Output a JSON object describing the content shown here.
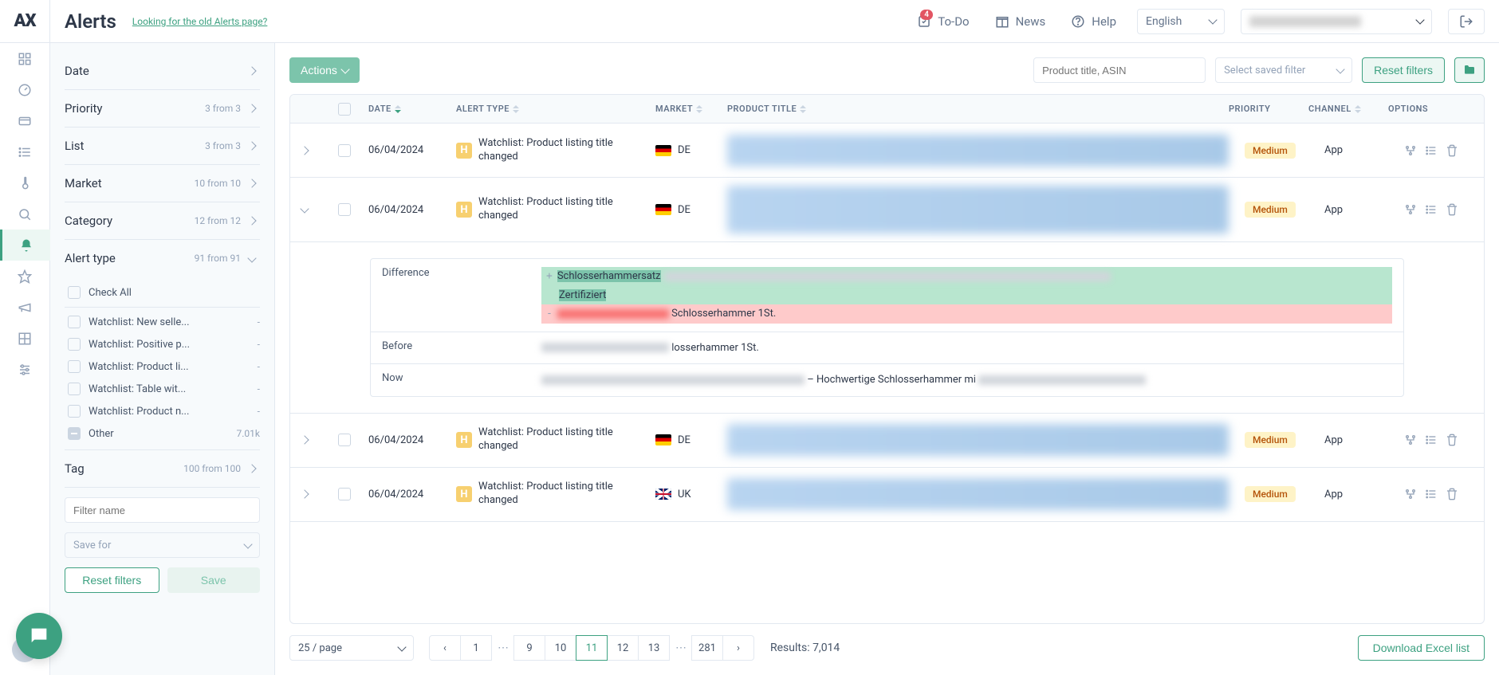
{
  "header": {
    "logo": "AX",
    "title": "Alerts",
    "old_link": "Looking for the old Alerts page?",
    "todo": {
      "label": "To-Do",
      "badge": "4"
    },
    "news": "News",
    "help": "Help",
    "language": "English"
  },
  "filters": {
    "date": {
      "label": "Date"
    },
    "priority": {
      "label": "Priority",
      "count": "3 from 3"
    },
    "list": {
      "label": "List",
      "count": "3 from 3"
    },
    "market": {
      "label": "Market",
      "count": "10 from 10"
    },
    "category": {
      "label": "Category",
      "count": "12 from 12"
    },
    "alert_type": {
      "label": "Alert type",
      "count": "91 from 91",
      "check_all": "Check All",
      "items": [
        {
          "label": "Watchlist: New selle...",
          "count": "-"
        },
        {
          "label": "Watchlist: Positive p...",
          "count": "-"
        },
        {
          "label": "Watchlist: Product li...",
          "count": "-"
        },
        {
          "label": "Watchlist: Table wit...",
          "count": "-"
        },
        {
          "label": "Watchlist: Product n...",
          "count": "-"
        }
      ],
      "other": {
        "label": "Other",
        "count": "7.01k"
      }
    },
    "tag": {
      "label": "Tag",
      "count": "100 from 100",
      "placeholder": "Filter name"
    },
    "save_for": "Save for",
    "reset": "Reset filters",
    "save": "Save"
  },
  "toolbar": {
    "actions": "Actions",
    "search_placeholder": "Product title, ASIN",
    "saved_filter": "Select saved filter",
    "reset": "Reset filters"
  },
  "table": {
    "headers": {
      "date": "DATE",
      "alert_type": "ALERT TYPE",
      "market": "MARKET",
      "product_title": "PRODUCT TITLE",
      "priority": "PRIORITY",
      "channel": "CHANNEL",
      "options": "OPTIONS"
    },
    "rows": [
      {
        "date": "06/04/2024",
        "alert": "Watchlist: Product listing title changed",
        "market": "DE",
        "flag": "de",
        "priority": "Medium",
        "channel": "App",
        "expanded": false
      },
      {
        "date": "06/04/2024",
        "alert": "Watchlist: Product listing title changed",
        "market": "DE",
        "flag": "de",
        "priority": "Medium",
        "channel": "App",
        "expanded": true
      },
      {
        "date": "06/04/2024",
        "alert": "Watchlist: Product listing title changed",
        "market": "DE",
        "flag": "de",
        "priority": "Medium",
        "channel": "App",
        "expanded": false
      },
      {
        "date": "06/04/2024",
        "alert": "Watchlist: Product listing title changed",
        "market": "UK",
        "flag": "uk",
        "priority": "Medium",
        "channel": "App",
        "expanded": false
      }
    ],
    "detail": {
      "difference": "Difference",
      "before": "Before",
      "now": "Now",
      "add_line1": "Schlosserhammersatz",
      "add_line2": "Zertifiziert",
      "rem_text": "Schlosserhammer 1St.",
      "before_text": "losserhammer 1St.",
      "now_text": "– Hochwertige Schlosserhammer mi"
    }
  },
  "footer": {
    "page_size": "25 / page",
    "pages": [
      "1",
      "9",
      "10",
      "11",
      "12",
      "13",
      "281"
    ],
    "active": "11",
    "results": "Results: 7,014",
    "download": "Download Excel list"
  }
}
